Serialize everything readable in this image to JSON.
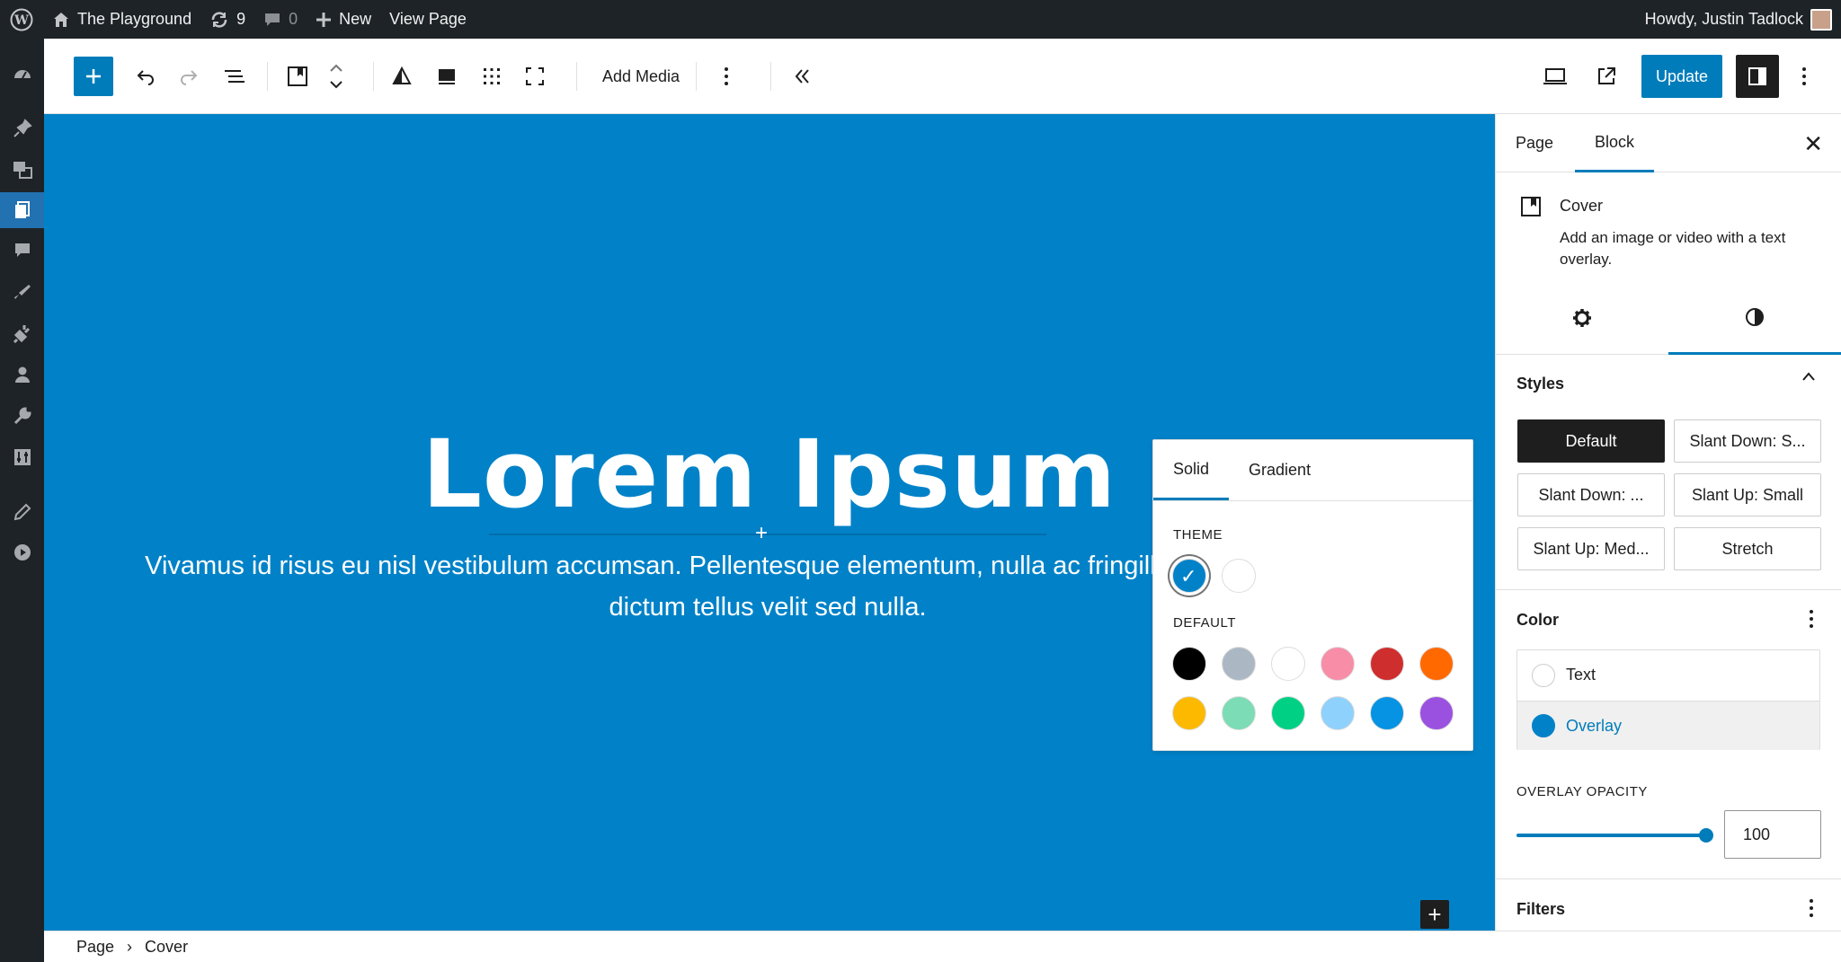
{
  "adminbar": {
    "site_name": "The Playground",
    "updates_count": "9",
    "comments_count": "0",
    "new_label": "New",
    "view_page_label": "View Page",
    "howdy": "Howdy, Justin Tadlock"
  },
  "toolbar": {
    "add_media_label": "Add Media",
    "update_label": "Update"
  },
  "canvas": {
    "title": "Lorem Ipsum",
    "text": "Vivamus id risus eu nisl vestibulum accumsan. Pellentesque elementum, nulla ac fringilla aliquet tortor, vitae dictum tellus velit sed nulla.",
    "background_color": "#0182c8"
  },
  "color_popover": {
    "tabs": [
      "Solid",
      "Gradient"
    ],
    "theme_label": "THEME",
    "default_label": "DEFAULT",
    "theme_colors": [
      "#0182c8",
      "#ffffff"
    ],
    "default_colors": [
      "#000000",
      "#abb8c3",
      "#ffffff",
      "#f78da7",
      "#cf2e2e",
      "#ff6900",
      "#fcb900",
      "#7bdcb5",
      "#00d084",
      "#8ed1fc",
      "#0693e3",
      "#9b51e0"
    ]
  },
  "panel": {
    "tab_page": "Page",
    "tab_block": "Block",
    "block_name": "Cover",
    "block_desc": "Add an image or video with a text overlay.",
    "styles_heading": "Styles",
    "styles": [
      "Default",
      "Slant Down: S...",
      "Slant Down: ...",
      "Slant Up: Small",
      "Slant Up: Med...",
      "Stretch"
    ],
    "color_heading": "Color",
    "color_text_label": "Text",
    "color_overlay_label": "Overlay",
    "overlay_opacity_label": "OVERLAY OPACITY",
    "overlay_opacity_value": "100",
    "filters_heading": "Filters"
  },
  "breadcrumb": {
    "page": "Page",
    "separator": "›",
    "block": "Cover"
  }
}
